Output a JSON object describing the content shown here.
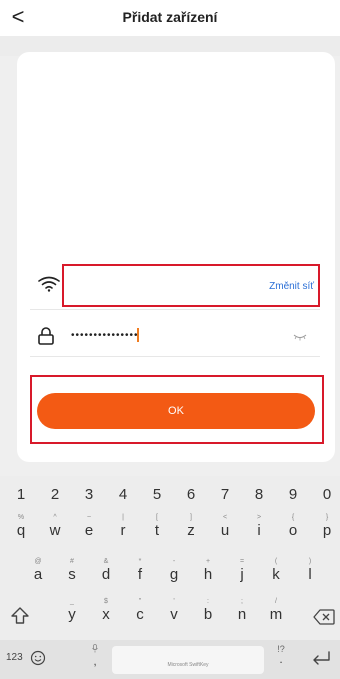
{
  "header": {
    "back_glyph": "<",
    "title": "Přidat zařízení"
  },
  "wifi": {
    "change_label": "Změnit síť"
  },
  "password": {
    "masked_value": "•••••••••••••••"
  },
  "ok_label": "OK",
  "keyboard": {
    "numbers": [
      "1",
      "2",
      "3",
      "4",
      "5",
      "6",
      "7",
      "8",
      "9",
      "0"
    ],
    "row1": [
      {
        "sub": "%",
        "main": "q"
      },
      {
        "sub": "^",
        "main": "w"
      },
      {
        "sub": "~",
        "main": "e"
      },
      {
        "sub": "|",
        "main": "r"
      },
      {
        "sub": "[",
        "main": "t"
      },
      {
        "sub": "]",
        "main": "z"
      },
      {
        "sub": "<",
        "main": "u"
      },
      {
        "sub": ">",
        "main": "i"
      },
      {
        "sub": "{",
        "main": "o"
      },
      {
        "sub": "}",
        "main": "p"
      }
    ],
    "row2": [
      {
        "sub": "@",
        "main": "a"
      },
      {
        "sub": "#",
        "main": "s"
      },
      {
        "sub": "&",
        "main": "d"
      },
      {
        "sub": "*",
        "main": "f"
      },
      {
        "sub": "-",
        "main": "g"
      },
      {
        "sub": "+",
        "main": "h"
      },
      {
        "sub": "=",
        "main": "j"
      },
      {
        "sub": "(",
        "main": "k"
      },
      {
        "sub": ")",
        "main": "l"
      }
    ],
    "row3": [
      {
        "sub": "_",
        "main": "y"
      },
      {
        "sub": "$",
        "main": "x"
      },
      {
        "sub": "\"",
        "main": "c"
      },
      {
        "sub": "'",
        "main": "v"
      },
      {
        "sub": ":",
        "main": "b"
      },
      {
        "sub": ";",
        "main": "n"
      },
      {
        "sub": "/",
        "main": "m"
      }
    ],
    "num_toggle": "123",
    "space_label": "Microsoft SwiftKey",
    "comma": ",",
    "period_sub": "!?",
    "period": "."
  },
  "colors": {
    "accent": "#f35a14",
    "highlight_box": "#d8192a",
    "link": "#2b6fd6"
  }
}
